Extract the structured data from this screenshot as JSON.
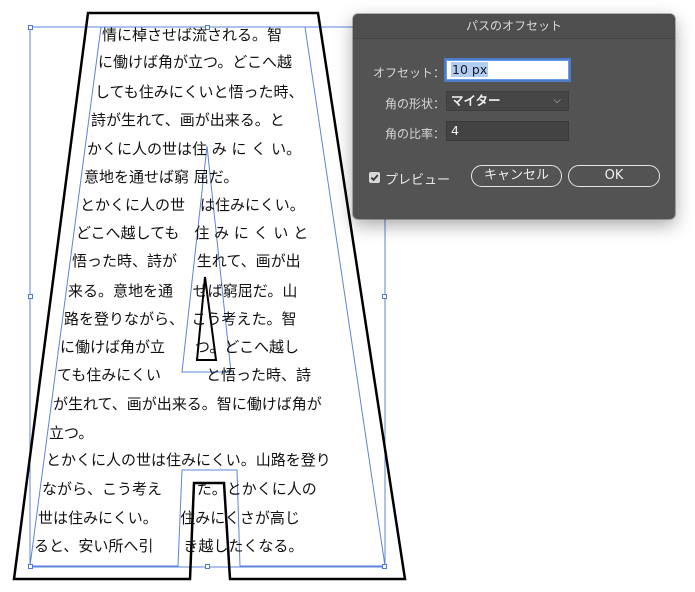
{
  "dialog": {
    "title": "パスのオフセット",
    "offset_label": "オフセット：",
    "offset_value": "10 px",
    "corner_label": "角の形状：",
    "corner_value": "マイター",
    "ratio_label": "角の比率：",
    "ratio_value": "4",
    "preview_label": "プレビュー",
    "preview_checked": true,
    "cancel_label": "キャンセル",
    "ok_label": "OK"
  },
  "artwork": {
    "text_lines": [
      "情に棹させば流される。智",
      "に働けば角が立つ。どこへ越",
      "しても住みにくいと悟った時、",
      "詩が生れて、画が出来る。と",
      "かくに人の世は住 み に く い。",
      "意地を通せば窮 屈だ。",
      "とかくに人の世　は住みにくい。",
      "どこへ越しても　住 み に く い と",
      "悟った時、詩が　 生れて、画が出",
      "来る。意地を通　 せば窮屈だ。山",
      "路を登りながら、　こう考えた。智",
      "に働けば角が立　　つ。どこへ越し",
      "ても住みにくい　　　と悟った時、詩",
      "が生れて、画が出来る。智に働けば角が",
      "立つ。",
      "とかくに人の世は住みにくい。山路を登り",
      "ながら、こう考え　　 た。とかくに人の",
      "世は住みにくい。　　住みにくさが高じ",
      "ると、安い所へ引　　き越したくなる。"
    ]
  }
}
